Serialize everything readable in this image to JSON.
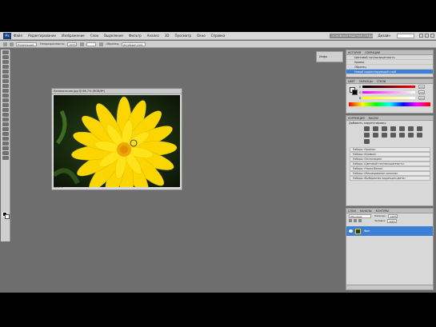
{
  "menubar": {
    "logo": "Ps",
    "items": [
      "Файл",
      "Редактирование",
      "Изображение",
      "Слои",
      "Выделение",
      "Фильтр",
      "Анализ",
      "3D",
      "Просмотр",
      "Окно",
      "Справка"
    ],
    "workspace_button": "ОСНОВНАЯ РАБОЧАЯ СРЕДА",
    "workspace_label": "Дизайн"
  },
  "options": {
    "field1": "Нормальный",
    "label2": "Непрозрачность:",
    "field2": "100%",
    "field3": "",
    "label4": "Образец:",
    "field4": "Активный слой"
  },
  "document": {
    "title": "Колокольчик.jpg @ 66,7% (RGB/8*)",
    "status": "66,67%"
  },
  "dock": {
    "label": "Инфо"
  },
  "history": {
    "tabs": [
      "ИСТОРИЯ",
      "ОПЕРАЦИИ"
    ],
    "rows": [
      "Цветовой тон/насыщенность",
      "Уровни",
      "Образец",
      "Новый корректирующий слой"
    ],
    "selected_index": 3
  },
  "color": {
    "tabs": [
      "ЦВЕТ",
      "ОБРАЗЦЫ",
      "СТИЛИ"
    ],
    "sliders": [
      {
        "label": "R",
        "value": "255",
        "gradient": "linear-gradient(to right,#000,#f00)"
      },
      {
        "label": "G",
        "value": "255",
        "gradient": "linear-gradient(to right,#f0f,#fff)"
      },
      {
        "label": "B",
        "value": "255",
        "gradient": "linear-gradient(to right,#ff0,#fff)"
      }
    ]
  },
  "adjustments": {
    "tabs": [
      "КОРРЕКЦИЯ",
      "МАСКИ"
    ],
    "header": "Добавить корректировку",
    "presets": [
      "Наборы «Уровни»",
      "Наборы «Кривые»",
      "Наборы «Экспозиция»",
      "Наборы «Цветовой тон/насыщенность»",
      "Наборы «Черно-белое»",
      "Наборы «Микширование каналов»",
      "Наборы «Выборочная коррекция цвета»"
    ]
  },
  "layers": {
    "tabs": [
      "СЛОИ",
      "КАНАЛЫ",
      "КОНТУРЫ"
    ],
    "blend_mode": "Обычные",
    "opacity_label": "Непрозр.:",
    "opacity_value": "100%",
    "fill_label": "Заливка:",
    "fill_value": "100%",
    "layer_name": "Фон"
  }
}
